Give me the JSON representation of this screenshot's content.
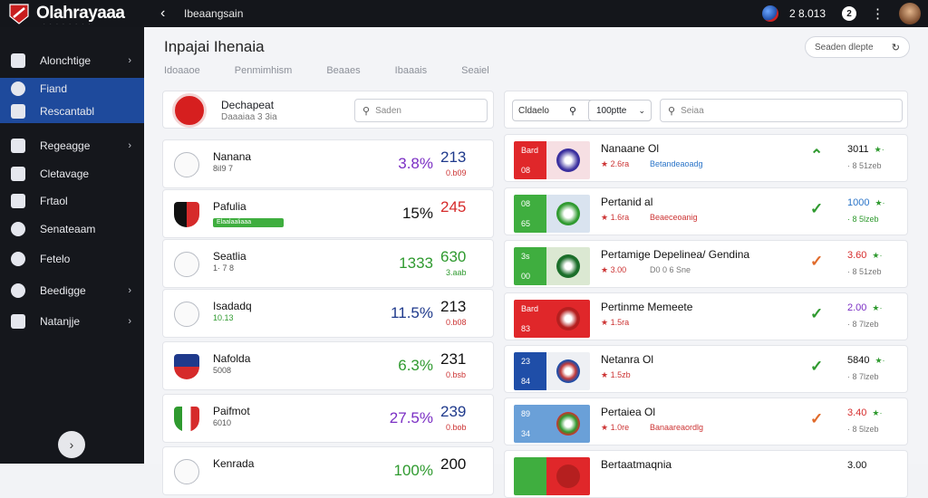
{
  "app": {
    "name": "Olahrayaaa",
    "subtitle": "· · · · · · · ·"
  },
  "topbar": {
    "back_icon": "back-arrow-icon",
    "breadcrumb": "Ibeaangsain",
    "number": "2 8.013",
    "circle_label": "2"
  },
  "sidebar": {
    "items": [
      {
        "label": "Alonchtige",
        "icon": "home-icon",
        "chevron": true
      },
      {
        "label": "Fiand",
        "icon": "team-icon",
        "chevron": false,
        "active": true
      },
      {
        "label": "Rescantabl",
        "icon": "stats-icon",
        "chevron": false,
        "active": true
      },
      {
        "label": "Regeagge",
        "icon": "calendar-icon",
        "chevron": true
      },
      {
        "label": "Cletavage",
        "icon": "trophy-icon",
        "chevron": false
      },
      {
        "label": "Frtaol",
        "icon": "tactics-icon",
        "chevron": false
      },
      {
        "label": "Senateaam",
        "icon": "globe-icon",
        "chevron": false
      },
      {
        "label": "Fetelo",
        "icon": "search-user-icon",
        "chevron": false
      },
      {
        "label": "Beedigge",
        "icon": "star-icon",
        "chevron": true
      },
      {
        "label": "Natanjje",
        "icon": "settings-icon",
        "chevron": true
      }
    ],
    "toggle_icon": "chevron-right-icon"
  },
  "main": {
    "title": "Inpajai Ihenaia",
    "sort_label": "Seaden dlepte",
    "tabs": [
      "Idoaaoe",
      "Penmimhism",
      "Beaaes",
      "Ibaaais",
      "Seaiel"
    ]
  },
  "left_panel": {
    "header": {
      "name": "Dechapeat",
      "sub": "Daaaiaa 3 3ia",
      "search_placeholder": "Saden"
    },
    "rows": [
      {
        "name": "Nanana",
        "sub": "8iI9 7",
        "pct": "3.8%",
        "pct_color": "#7b2fc4",
        "val": "213",
        "val_color": "#1f3a8c",
        "chg": "0.b09"
      },
      {
        "name": "Pafulia",
        "bar": "Elaalaaliaaa",
        "pct": "15%",
        "pct_color": "#111111",
        "val": "245",
        "val_color": "#d62b2b",
        "chg": ""
      },
      {
        "name": "Seatlia",
        "sub": "1· 7 8",
        "pct": "1333",
        "pct_color": "#2f9a2f",
        "val": "630",
        "val_color": "#2f9a2f",
        "chg": "3.aab"
      },
      {
        "name": "Isadadq",
        "sub": "10.13",
        "sub_green": true,
        "pct": "11.5%",
        "pct_color": "#1f3a8c",
        "val": "213",
        "val_color": "#111111",
        "chg": "0.b08"
      },
      {
        "name": "Nafolda",
        "sub": "5008",
        "pct": "6.3%",
        "pct_color": "#2f9a2f",
        "val": "231",
        "val_color": "#111111",
        "chg": "0.bsb"
      },
      {
        "name": "Paifmot",
        "sub": "6010",
        "pct": "27.5%",
        "pct_color": "#7b2fc4",
        "val": "239",
        "val_color": "#1f3a8c",
        "chg": "0.bob"
      },
      {
        "name": "Kenrada",
        "sub": "",
        "pct": "100%",
        "pct_color": "#2f9a2f",
        "val": "200",
        "val_color": "#111111",
        "chg": ""
      }
    ]
  },
  "right_panel": {
    "header": {
      "filter_label": "Cldaelo",
      "filter_icon": "search-icon",
      "select_value": "100ptte",
      "search_placeholder": "Seiaa"
    },
    "rows": [
      {
        "l_color": "#e0272a",
        "r_color": "#f6dfe3",
        "ball": "#3a2f9e",
        "top": "Bard",
        "bot": "08",
        "name": "Nanaane Ol",
        "m1": "★ 2.6ra",
        "m2": "Betandeaoadg",
        "m2_style": "",
        "mark": "^",
        "mark_color": "#2f9a2f",
        "val": "3011",
        "val_st": "★·",
        "val_color": "#111111",
        "sub": "· 8 51zeb"
      },
      {
        "l_color": "#3fae3f",
        "r_color": "#d9e3ef",
        "ball": "#2f9a2f",
        "top": "08",
        "bot": "65",
        "name": "Pertanid al",
        "m1": "★ 1.6ra",
        "m2": "Beaeceoanig",
        "m2_style": "red",
        "mark": "✓",
        "mark_color": "#2f9a2f",
        "val": "1000",
        "val_st": "★·",
        "val_color": "#2a74c8",
        "sub": "· 8 5lzeb"
      },
      {
        "l_color": "#3fae3f",
        "r_color": "#dbe8d2",
        "ball": "#1b6e2a",
        "top": "3s",
        "bot": "00",
        "name": "Pertamige Depelinea/ Gendina",
        "m1": "★ 3.00",
        "m2": "D0 0 6 Sne",
        "m2_style": "grey",
        "mark": "✓",
        "mark_color": "#e06a2a",
        "val": "3.60",
        "val_st": "★·",
        "val_color": "#d62b2b",
        "sub": "· 8 51zeb"
      },
      {
        "l_color": "#e0272a",
        "r_color": "#e0272a",
        "ball": "#b51f1f",
        "top": "Bard",
        "bot": "83",
        "name": "Pertinme Memeete",
        "m1": "★ 1.5ra",
        "m2": "",
        "m2_style": "",
        "mark": "✓",
        "mark_color": "#2f9a2f",
        "val": "2.00",
        "val_st": "★·",
        "val_color": "#7b2fc4",
        "sub": "· 8 7lzeb"
      },
      {
        "l_color": "#1f4ea8",
        "r_color": "#eef0f4",
        "ball": "#c23a3a",
        "top": "23",
        "bot": "84",
        "name": "Netanra Ol",
        "m1": "★ 1.5zb",
        "m2": "",
        "m2_style": "",
        "mark": "✓",
        "mark_color": "#2f9a2f",
        "val": "5840",
        "val_st": "★·",
        "val_color": "#111111",
        "sub": "· 8 7lzeb"
      },
      {
        "l_color": "#6aa0d8",
        "r_color": "#6aa0d8",
        "ball": "#2f9a2f",
        "top": "89",
        "bot": "34",
        "name": "Pertaiea Ol",
        "m1": "★ 1.0re",
        "m2": "Banaareaordlg",
        "m2_style": "red",
        "mark": "✓",
        "mark_color": "#e06a2a",
        "val": "3.40",
        "val_st": "★·",
        "val_color": "#d62b2b",
        "sub": "· 8 5lzeb"
      },
      {
        "l_color": "#3fae3f",
        "r_color": "#e0272a",
        "ball": "#b51f1f",
        "top": "",
        "bot": "",
        "name": "Bertaatmaqnia",
        "m1": "",
        "m2": "",
        "m2_style": "",
        "mark": "",
        "mark_color": "#2f9a2f",
        "val": "3.00",
        "val_st": "",
        "val_color": "#111111",
        "sub": ""
      }
    ]
  }
}
